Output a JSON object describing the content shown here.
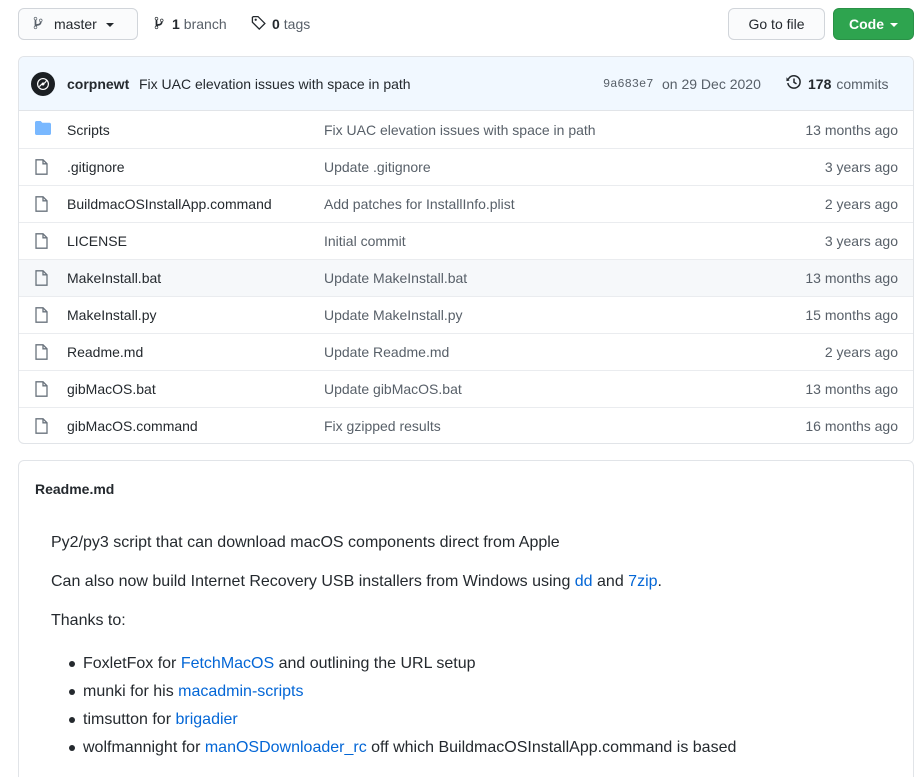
{
  "toolbar": {
    "branch_name": "master",
    "branch_count": "1",
    "branch_label": "branch",
    "tag_count": "0",
    "tag_label": "tags",
    "go_to_file": "Go to file",
    "code": "Code"
  },
  "latest_commit": {
    "author": "corpnewt",
    "message": "Fix UAC elevation issues with space in path",
    "sha": "9a683e7",
    "date": "on 29 Dec 2020",
    "commit_count": "178",
    "commit_label": "commits"
  },
  "files": [
    {
      "type": "folder",
      "name": "Scripts",
      "message": "Fix UAC elevation issues with space in path",
      "age": "13 months ago"
    },
    {
      "type": "file",
      "name": ".gitignore",
      "message": "Update .gitignore",
      "age": "3 years ago"
    },
    {
      "type": "file",
      "name": "BuildmacOSInstallApp.command",
      "message": "Add patches for InstallInfo.plist",
      "age": "2 years ago"
    },
    {
      "type": "file",
      "name": "LICENSE",
      "message": "Initial commit",
      "age": "3 years ago"
    },
    {
      "type": "file",
      "name": "MakeInstall.bat",
      "message": "Update MakeInstall.bat",
      "age": "13 months ago"
    },
    {
      "type": "file",
      "name": "MakeInstall.py",
      "message": "Update MakeInstall.py",
      "age": "15 months ago"
    },
    {
      "type": "file",
      "name": "Readme.md",
      "message": "Update Readme.md",
      "age": "2 years ago"
    },
    {
      "type": "file",
      "name": "gibMacOS.bat",
      "message": "Update gibMacOS.bat",
      "age": "13 months ago"
    },
    {
      "type": "file",
      "name": "gibMacOS.command",
      "message": "Fix gzipped results",
      "age": "16 months ago"
    }
  ],
  "readme": {
    "title": "Readme.md",
    "intro": "Py2/py3 script that can download macOS components direct from Apple",
    "line2_prefix": "Can also now build Internet Recovery USB installers from Windows using ",
    "link_dd": "dd",
    "line2_and": " and ",
    "link_7zip": "7zip",
    "line2_suffix": ".",
    "thanks": "Thanks to:",
    "credits": [
      {
        "prefix": "FoxletFox for ",
        "link": "FetchMacOS",
        "suffix": " and outlining the URL setup"
      },
      {
        "prefix": "munki for his ",
        "link": "macadmin-scripts",
        "suffix": ""
      },
      {
        "prefix": "timsutton for ",
        "link": "brigadier",
        "suffix": ""
      },
      {
        "prefix": "wolfmannight for ",
        "link": "manOSDownloader_rc",
        "suffix": " off which BuildmacOSInstallApp.command is based"
      }
    ]
  }
}
